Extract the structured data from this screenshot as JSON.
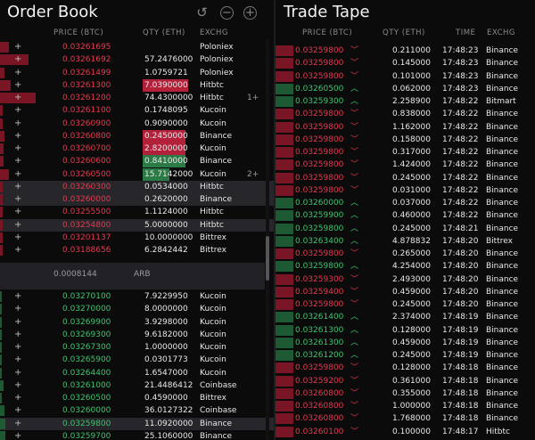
{
  "order_book": {
    "title": "Order Book",
    "headers": {
      "price": "PRICE (BTC)",
      "qty": "QTY (ETH)",
      "exch": "EXCHG"
    },
    "tools": {
      "reset": "↺",
      "zoom_out": "−",
      "zoom_in": "+"
    },
    "asks": [
      {
        "price": "0.03261695",
        "qty": "",
        "exch": "Poloniex",
        "depth": 0.1,
        "qtyfill": 0,
        "hl": false,
        "note": ""
      },
      {
        "price": "0.03261692",
        "qty": "57.2476000",
        "exch": "Poloniex",
        "depth": 0.32,
        "qtyfill": 0,
        "hl": false,
        "note": ""
      },
      {
        "price": "0.03261499",
        "qty": "1.0759721",
        "exch": "Poloniex",
        "depth": 0.05,
        "qtyfill": 0,
        "hl": false,
        "note": ""
      },
      {
        "price": "0.03261300",
        "qty": "7.0390000",
        "exch": "Hitbtc",
        "depth": 0.12,
        "qtyfill": 0.85,
        "hl": false,
        "note": ""
      },
      {
        "price": "0.03261200",
        "qty": "74.4300000",
        "exch": "Hitbtc",
        "depth": 0.4,
        "qtyfill": 0,
        "hl": false,
        "note": "1+"
      },
      {
        "price": "0.03261100",
        "qty": "0.1748095",
        "exch": "Kucoin",
        "depth": 0.03,
        "qtyfill": 0,
        "hl": false,
        "note": ""
      },
      {
        "price": "0.03260900",
        "qty": "0.9090000",
        "exch": "Kucoin",
        "depth": 0.03,
        "qtyfill": 0,
        "hl": false,
        "note": ""
      },
      {
        "price": "0.03260800",
        "qty": "0.2450000",
        "exch": "Binance",
        "depth": 0.05,
        "qtyfill": 0.8,
        "hl": false,
        "note": ""
      },
      {
        "price": "0.03260700",
        "qty": "2.8200000",
        "exch": "Kucoin",
        "depth": 0.04,
        "qtyfill": 0.8,
        "hl": false,
        "note": ""
      },
      {
        "price": "0.03260600",
        "qty": "0.8410000",
        "exch": "Binance",
        "depth": 0.04,
        "qtyfill": 0.8,
        "hl": false,
        "note": ""
      },
      {
        "price": "0.03260500",
        "qty": "15.7142000",
        "exch": "Kucoin",
        "depth": 0.1,
        "qtyfill": 0.5,
        "hl": false,
        "note": "2+"
      },
      {
        "price": "0.03260300",
        "qty": "0.0534000",
        "exch": "Hitbtc",
        "depth": 0.03,
        "qtyfill": 0,
        "hl": true,
        "note": ""
      },
      {
        "price": "0.03260000",
        "qty": "0.2620000",
        "exch": "Binance",
        "depth": 0.03,
        "qtyfill": 0,
        "hl": true,
        "note": ""
      },
      {
        "price": "0.03255500",
        "qty": "1.1124000",
        "exch": "Hitbtc",
        "depth": 0.03,
        "qtyfill": 0,
        "hl": false,
        "note": ""
      },
      {
        "price": "0.03254800",
        "qty": "5.0000000",
        "exch": "Hitbtc",
        "depth": 0.03,
        "qtyfill": 0,
        "hl": true,
        "note": ""
      },
      {
        "price": "0.03201137",
        "qty": "10.0000000",
        "exch": "Bittrex",
        "depth": 0.03,
        "qtyfill": 0,
        "hl": false,
        "note": ""
      },
      {
        "price": "0.03188656",
        "qty": "6.2842442",
        "exch": "Bittrex",
        "depth": 0.03,
        "qtyfill": 0,
        "hl": false,
        "note": ""
      }
    ],
    "spread": {
      "value": "0.0008144",
      "label": "ARB"
    },
    "bids": [
      {
        "price": "0.03270100",
        "qty": "7.9229950",
        "exch": "Kucoin",
        "depth": 0.02,
        "hl": false
      },
      {
        "price": "0.03270000",
        "qty": "8.0000000",
        "exch": "Kucoin",
        "depth": 0.02,
        "hl": false
      },
      {
        "price": "0.03269900",
        "qty": "3.9298000",
        "exch": "Kucoin",
        "depth": 0.02,
        "hl": false
      },
      {
        "price": "0.03269300",
        "qty": "9.6182000",
        "exch": "Kucoin",
        "depth": 0.02,
        "hl": false
      },
      {
        "price": "0.03267300",
        "qty": "1.0000000",
        "exch": "Kucoin",
        "depth": 0.02,
        "hl": false
      },
      {
        "price": "0.03265900",
        "qty": "0.0301773",
        "exch": "Kucoin",
        "depth": 0.02,
        "hl": false
      },
      {
        "price": "0.03264400",
        "qty": "1.6547000",
        "exch": "Kucoin",
        "depth": 0.02,
        "hl": false
      },
      {
        "price": "0.03261000",
        "qty": "21.4486412",
        "exch": "Coinbase",
        "depth": 0.04,
        "hl": false
      },
      {
        "price": "0.03260500",
        "qty": "0.4590000",
        "exch": "Bittrex",
        "depth": 0.02,
        "hl": false
      },
      {
        "price": "0.03260000",
        "qty": "36.0127322",
        "exch": "Coinbase",
        "depth": 0.05,
        "hl": false
      },
      {
        "price": "0.03259800",
        "qty": "11.0920000",
        "exch": "Binance",
        "depth": 0.06,
        "hl": true
      },
      {
        "price": "0.03259700",
        "qty": "25.1060000",
        "exch": "Binance",
        "depth": 0.06,
        "hl": false
      }
    ]
  },
  "trade_tape": {
    "title": "Trade Tape",
    "headers": {
      "price": "PRICE (BTC)",
      "qty": "QTY (ETH)",
      "time": "TIME",
      "exch": "EXCHG"
    },
    "trades": [
      {
        "price": "0.03259800",
        "side": "sell",
        "qty": "0.211000",
        "time": "17:48:23",
        "exch": "Binance"
      },
      {
        "price": "0.03259800",
        "side": "sell",
        "qty": "0.145000",
        "time": "17:48:23",
        "exch": "Binance"
      },
      {
        "price": "0.03259800",
        "side": "sell",
        "qty": "0.101000",
        "time": "17:48:23",
        "exch": "Binance"
      },
      {
        "price": "0.03260500",
        "side": "buy",
        "qty": "0.062000",
        "time": "17:48:23",
        "exch": "Binance"
      },
      {
        "price": "0.03259300",
        "side": "buy",
        "qty": "2.258900",
        "time": "17:48:22",
        "exch": "Bitmart"
      },
      {
        "price": "0.03259800",
        "side": "sell",
        "qty": "0.838000",
        "time": "17:48:22",
        "exch": "Binance"
      },
      {
        "price": "0.03259800",
        "side": "sell",
        "qty": "1.162000",
        "time": "17:48:22",
        "exch": "Binance"
      },
      {
        "price": "0.03259800",
        "side": "sell",
        "qty": "0.158000",
        "time": "17:48:22",
        "exch": "Binance"
      },
      {
        "price": "0.03259800",
        "side": "sell",
        "qty": "0.317000",
        "time": "17:48:22",
        "exch": "Binance"
      },
      {
        "price": "0.03259800",
        "side": "sell",
        "qty": "1.424000",
        "time": "17:48:22",
        "exch": "Binance"
      },
      {
        "price": "0.03259800",
        "side": "sell",
        "qty": "0.245000",
        "time": "17:48:22",
        "exch": "Binance"
      },
      {
        "price": "0.03259800",
        "side": "sell",
        "qty": "0.031000",
        "time": "17:48:22",
        "exch": "Binance"
      },
      {
        "price": "0.03260000",
        "side": "buy",
        "qty": "0.037000",
        "time": "17:48:22",
        "exch": "Binance"
      },
      {
        "price": "0.03259900",
        "side": "buy",
        "qty": "0.460000",
        "time": "17:48:22",
        "exch": "Binance"
      },
      {
        "price": "0.03259800",
        "side": "buy",
        "qty": "0.245000",
        "time": "17:48:21",
        "exch": "Binance"
      },
      {
        "price": "0.03263400",
        "side": "buy",
        "qty": "4.878832",
        "time": "17:48:20",
        "exch": "Bittrex"
      },
      {
        "price": "0.03259800",
        "side": "sell",
        "qty": "0.265000",
        "time": "17:48:20",
        "exch": "Binance"
      },
      {
        "price": "0.03259800",
        "side": "buy",
        "qty": "4.254000",
        "time": "17:48:20",
        "exch": "Binance"
      },
      {
        "price": "0.03259300",
        "side": "sell",
        "qty": "2.493000",
        "time": "17:48:20",
        "exch": "Binance"
      },
      {
        "price": "0.03259400",
        "side": "sell",
        "qty": "0.459000",
        "time": "17:48:20",
        "exch": "Binance"
      },
      {
        "price": "0.03259800",
        "side": "sell",
        "qty": "0.245000",
        "time": "17:48:20",
        "exch": "Binance"
      },
      {
        "price": "0.03261400",
        "side": "buy",
        "qty": "2.374000",
        "time": "17:48:19",
        "exch": "Binance"
      },
      {
        "price": "0.03261300",
        "side": "buy",
        "qty": "0.128000",
        "time": "17:48:19",
        "exch": "Binance"
      },
      {
        "price": "0.03261300",
        "side": "buy",
        "qty": "0.459000",
        "time": "17:48:19",
        "exch": "Binance"
      },
      {
        "price": "0.03261200",
        "side": "buy",
        "qty": "0.245000",
        "time": "17:48:19",
        "exch": "Binance"
      },
      {
        "price": "0.03259800",
        "side": "sell",
        "qty": "0.128000",
        "time": "17:48:18",
        "exch": "Binance"
      },
      {
        "price": "0.03259200",
        "side": "sell",
        "qty": "0.361000",
        "time": "17:48:18",
        "exch": "Binance"
      },
      {
        "price": "0.03260800",
        "side": "sell",
        "qty": "0.355000",
        "time": "17:48:18",
        "exch": "Binance"
      },
      {
        "price": "0.03260800",
        "side": "sell",
        "qty": "1.000000",
        "time": "17:48:18",
        "exch": "Binance"
      },
      {
        "price": "0.03260800",
        "side": "sell",
        "qty": "1.768000",
        "time": "17:48:18",
        "exch": "Binance"
      },
      {
        "price": "0.03260100",
        "side": "sell",
        "qty": "0.100000",
        "time": "17:48:17",
        "exch": "Hitbtc"
      }
    ]
  },
  "colors": {
    "ask": "#e53a4f",
    "bid": "#3ec46d",
    "ask_bar": "#7a1526",
    "bid_bar": "#1d5a33",
    "ask_qty": "#b3203a",
    "bid_qty": "#2c7a45"
  }
}
